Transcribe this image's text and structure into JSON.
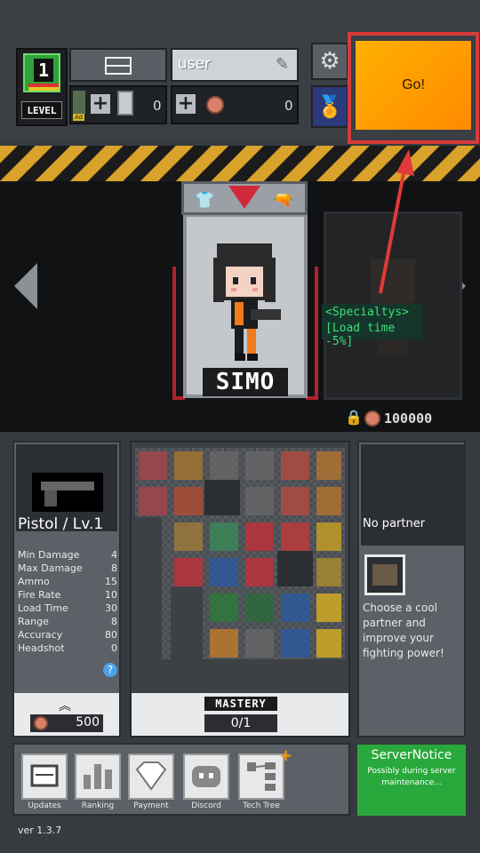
{
  "top": {
    "level": "1",
    "level_label": "LEVEL",
    "username": "user",
    "ticket_ad_label": "Ad",
    "ticket_count": "0",
    "coin_count": "0",
    "go_label": "Go!"
  },
  "character": {
    "name": "SIMO",
    "tooltip_line1": "<Specialtys>",
    "tooltip_line2": "[Load time -5%]",
    "locked_price": "100000"
  },
  "weapon": {
    "name": "Pistol / Lv.1",
    "stats": [
      {
        "label": "Min Damage",
        "value": "4"
      },
      {
        "label": "Max Damage",
        "value": "8"
      },
      {
        "label": "Ammo",
        "value": "15"
      },
      {
        "label": "Fire Rate",
        "value": "10"
      },
      {
        "label": "Load Time",
        "value": "30"
      },
      {
        "label": "Range",
        "value": "8"
      },
      {
        "label": "Accuracy",
        "value": "80"
      },
      {
        "label": "Headshot",
        "value": "0"
      }
    ],
    "help": "?",
    "upgrade_cost": "500"
  },
  "mastery": {
    "label": "MASTERY",
    "progress": "0/1"
  },
  "partner": {
    "status": "No partner",
    "description": "Choose a cool partner and improve your fighting power!"
  },
  "nav": {
    "items": [
      {
        "label": "Updates",
        "icon": "updates-icon"
      },
      {
        "label": "Ranking",
        "icon": "ranking-icon"
      },
      {
        "label": "Payment",
        "icon": "diamond-icon"
      },
      {
        "label": "Discord",
        "icon": "discord-icon"
      },
      {
        "label": "Tech Tree",
        "icon": "tech-tree-icon"
      }
    ]
  },
  "server_notice": {
    "title": "ServerNotice",
    "text": "Possibly during server maintenance..."
  },
  "version": "ver 1.3.7",
  "colors": {
    "accent_go": "#ff9a00",
    "highlight_red": "#d83a3a",
    "notice_green": "#29a93c",
    "tooltip_green": "#3ce07a"
  }
}
